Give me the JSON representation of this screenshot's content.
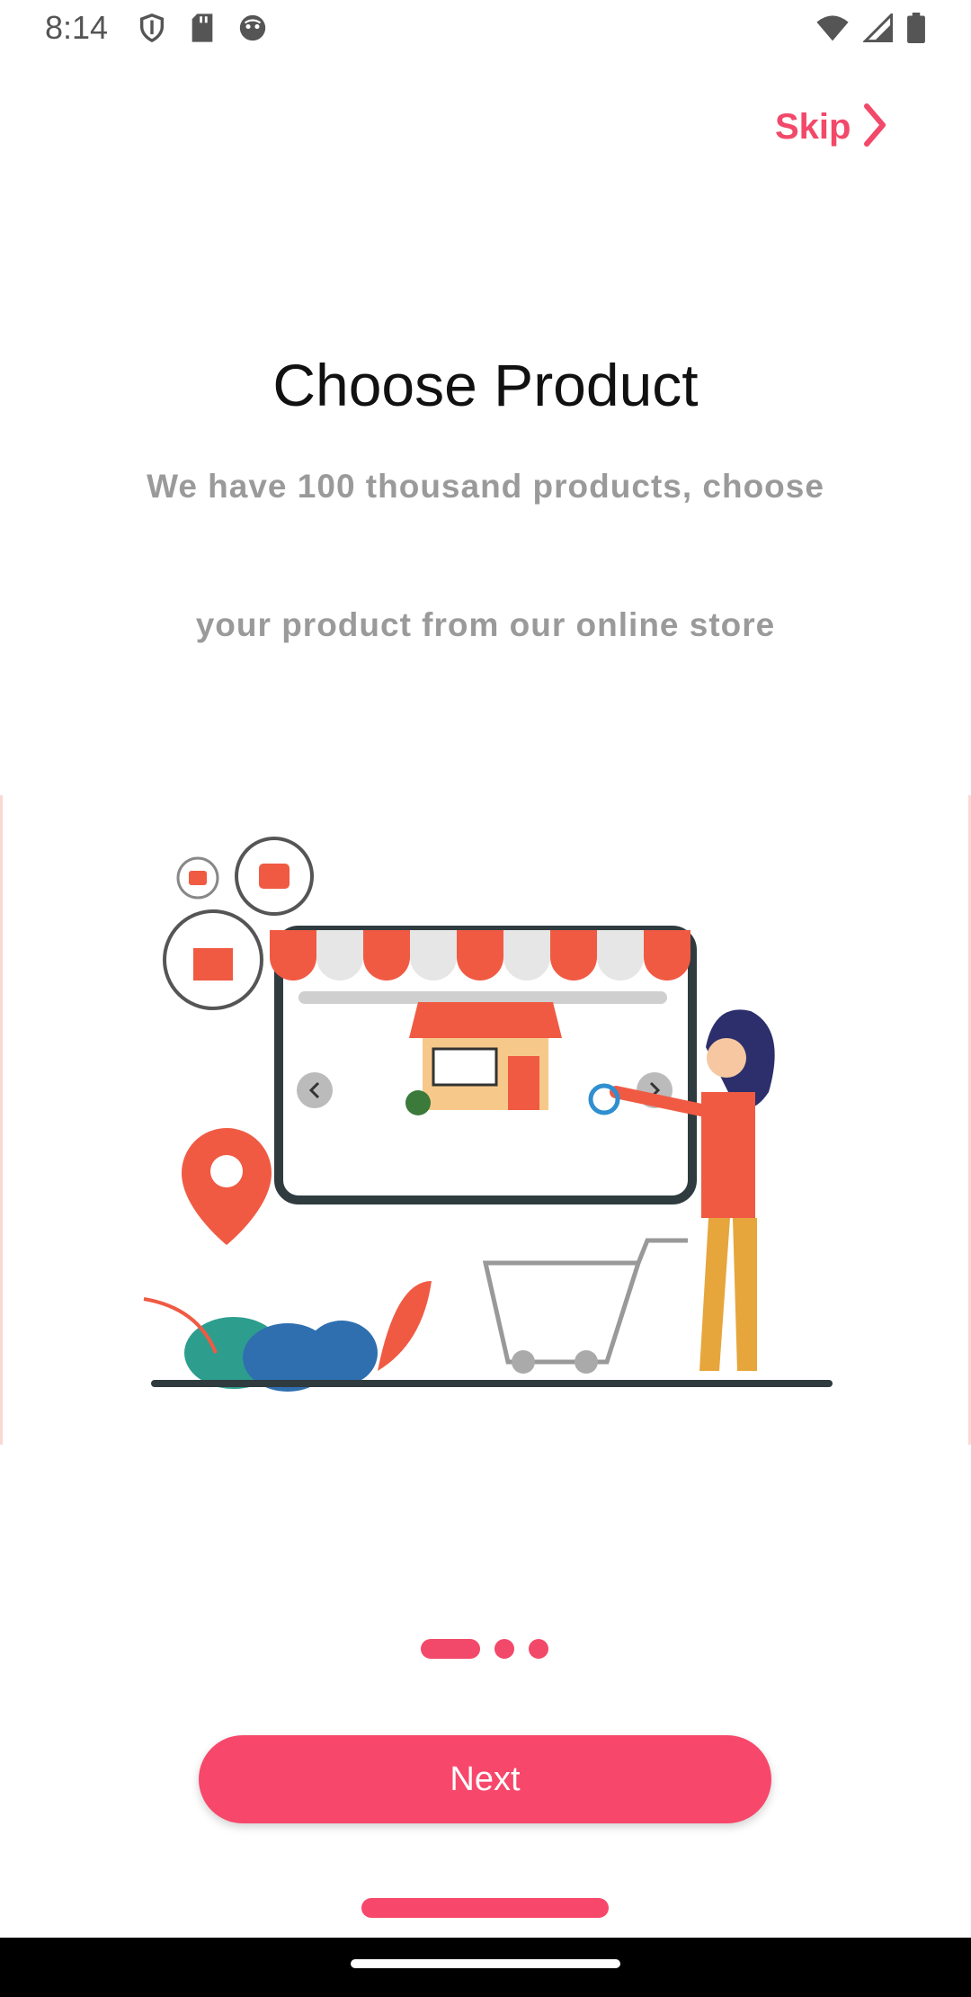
{
  "status_bar": {
    "time": "8:14",
    "left_icons": [
      "shield-icon",
      "sd-card-icon",
      "face-icon"
    ],
    "right_icons": [
      "wifi-icon",
      "signal-icon",
      "battery-icon"
    ]
  },
  "skip": {
    "label": "Skip",
    "icon": "chevron-right-icon"
  },
  "onboarding": {
    "title": "Choose Product",
    "description_line1": "We have 100 thousand products, choose",
    "description_line2": "your product from our online store"
  },
  "pager": {
    "total_pages": 3,
    "active_page": 1
  },
  "next_button": {
    "label": "Next"
  },
  "colors": {
    "accent": "#f7476a",
    "text_muted": "#9a9a9a"
  }
}
